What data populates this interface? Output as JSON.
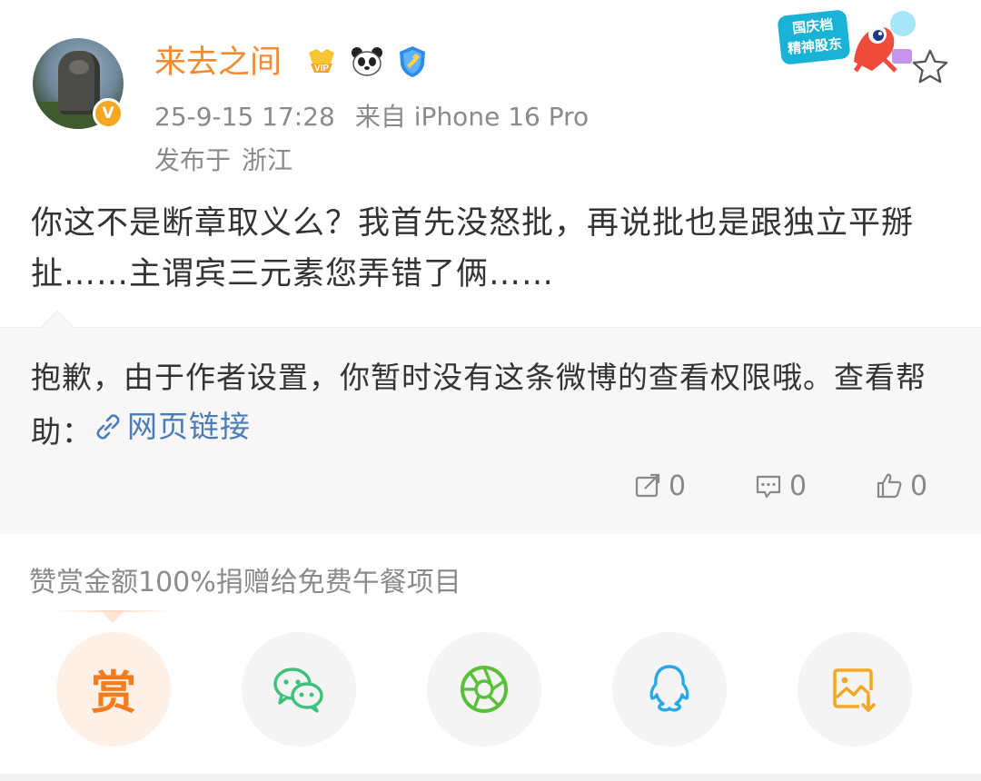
{
  "header": {
    "username": "来去之间",
    "verified_badge": "V",
    "badges": [
      "vip-badge-icon",
      "panda-badge-icon",
      "shield-badge-icon"
    ],
    "timestamp": "25-9-15 17:28",
    "source": "来自 iPhone 16 Pro",
    "location_label": "发布于",
    "location": "浙江",
    "promo_tag": "国庆档\n精神股东"
  },
  "post": {
    "text": "你这不是断章取义么？我首先没怒批，再说批也是跟独立平掰扯……主谓宾三元素您弄错了俩……"
  },
  "restricted": {
    "message": "抱歉，由于作者设置，你暂时没有这条微博的查看权限哦。查看帮助：",
    "link_text": "网页链接",
    "repost_count": "0",
    "comment_count": "0",
    "like_count": "0"
  },
  "reward": {
    "note": "赞赏金额100%捐赠给免费午餐项目",
    "reward_label": "赏"
  },
  "colors": {
    "username": "#f28a2e",
    "link": "#4a7bb7",
    "reward": "#f47c20",
    "wechat": "#3cc07a",
    "moments": "#5cbf3a",
    "qq": "#2aa7e8",
    "save": "#f5a623"
  }
}
